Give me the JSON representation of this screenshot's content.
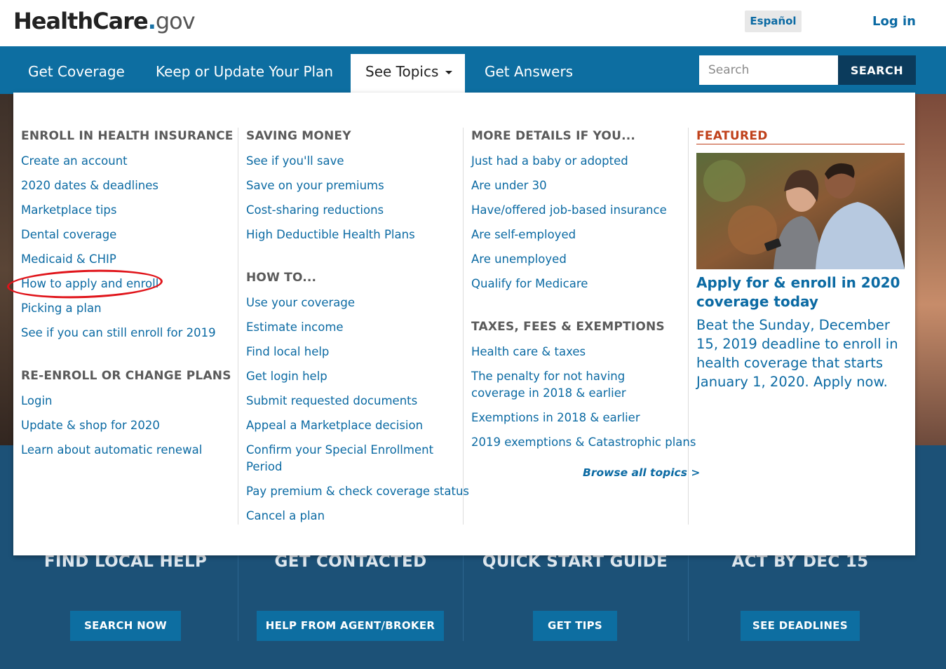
{
  "header": {
    "logo_main": "HealthCare",
    "logo_dot": ".",
    "logo_gov": "gov",
    "espanol": "Español",
    "login": "Log in"
  },
  "nav": {
    "items": [
      "Get Coverage",
      "Keep or Update Your Plan",
      "See Topics",
      "Get Answers"
    ],
    "search_placeholder": "Search",
    "search_button": "SEARCH"
  },
  "menu": {
    "col1": {
      "heading1": "ENROLL IN HEALTH INSURANCE",
      "links1": [
        "Create an account",
        "2020 dates & deadlines",
        "Marketplace tips",
        "Dental coverage",
        "Medicaid & CHIP",
        "How to apply and enroll",
        "Picking a plan",
        "See if you can still enroll for 2019"
      ],
      "heading2": "RE-ENROLL OR CHANGE PLANS",
      "links2": [
        "Login",
        "Update & shop for 2020",
        "Learn about automatic renewal"
      ]
    },
    "col2": {
      "heading1": "SAVING MONEY",
      "links1": [
        "See if you'll save",
        "Save on your premiums",
        "Cost-sharing reductions",
        "High Deductible Health Plans"
      ],
      "heading2": "HOW TO...",
      "links2": [
        "Use your coverage",
        "Estimate income",
        "Find local help",
        "Get login help",
        "Submit requested documents",
        "Appeal a Marketplace decision",
        "Confirm your Special Enrollment Period",
        "Pay premium & check coverage status",
        "Cancel a plan"
      ]
    },
    "col3": {
      "heading1": "MORE DETAILS IF YOU...",
      "links1": [
        "Just had a baby or adopted",
        "Are under 30",
        "Have/offered job-based insurance",
        "Are self-employed",
        "Are unemployed",
        "Qualify for Medicare"
      ],
      "heading2": "TAXES, FEES & EXEMPTIONS",
      "links2": [
        "Health care & taxes",
        "The penalty for not having coverage in 2018 & earlier",
        "Exemptions in 2018 & earlier",
        "2019 exemptions & Catastrophic plans"
      ],
      "browse": "Browse all topics >"
    },
    "featured": {
      "heading": "FEATURED",
      "title": "Apply for & enroll in 2020 coverage today",
      "body": "Beat the Sunday, December 15, 2019 deadline to enroll in health coverage that starts January 1, 2020. Apply now."
    }
  },
  "cards": [
    {
      "title": "FIND LOCAL HELP",
      "button": "SEARCH NOW"
    },
    {
      "title": "GET CONTACTED",
      "button": "HELP FROM AGENT/BROKER"
    },
    {
      "title": "QUICK START GUIDE",
      "button": "GET TIPS"
    },
    {
      "title": "ACT BY DEC 15",
      "button": "SEE DEADLINES"
    }
  ],
  "colors": {
    "nav_bg": "#0d6ea1",
    "link": "#0b6aa3",
    "featured_accent": "#c0421c",
    "annotation": "#e0141a"
  }
}
